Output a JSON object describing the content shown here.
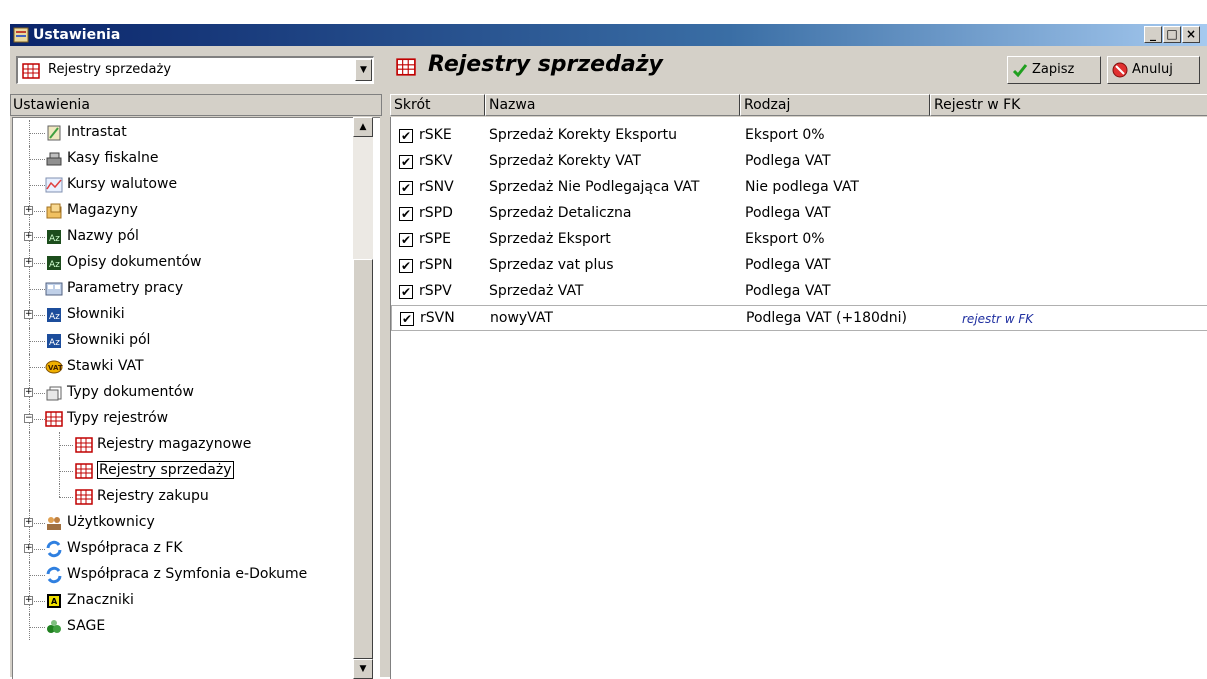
{
  "window": {
    "title": "Ustawienia",
    "controls": [
      "_",
      "□",
      "×"
    ]
  },
  "left": {
    "combo_value": "Rejestry sprzedaży",
    "header": "Ustawienia",
    "tree": [
      {
        "label": "Intrastat",
        "icon": "intrastat-icon",
        "expandable": false,
        "level": 1
      },
      {
        "label": "Kasy fiskalne",
        "icon": "cash-register-icon",
        "expandable": false,
        "level": 1
      },
      {
        "label": "Kursy walutowe",
        "icon": "chart-icon",
        "expandable": false,
        "level": 1
      },
      {
        "label": "Magazyny",
        "icon": "warehouse-icon",
        "expandable": true,
        "level": 1
      },
      {
        "label": "Nazwy pól",
        "icon": "az-green-icon",
        "expandable": true,
        "level": 1
      },
      {
        "label": "Opisy dokumentów",
        "icon": "az-green-icon",
        "expandable": true,
        "level": 1
      },
      {
        "label": "Parametry pracy",
        "icon": "parameters-icon",
        "expandable": false,
        "level": 1
      },
      {
        "label": "Słowniki",
        "icon": "az-blue-icon",
        "expandable": true,
        "level": 1
      },
      {
        "label": "Słowniki pól",
        "icon": "az-blue-icon",
        "expandable": false,
        "level": 1
      },
      {
        "label": "Stawki VAT",
        "icon": "vat-icon",
        "expandable": false,
        "level": 1
      },
      {
        "label": "Typy dokumentów",
        "icon": "documents-icon",
        "expandable": true,
        "level": 1
      },
      {
        "label": "Typy rejestrów",
        "icon": "register-icon",
        "expandable": true,
        "expanded": true,
        "level": 1
      },
      {
        "label": "Rejestry magazynowe",
        "icon": "register-icon",
        "expandable": false,
        "level": 2
      },
      {
        "label": "Rejestry sprzedaży",
        "icon": "register-icon",
        "expandable": false,
        "level": 2,
        "selected": true
      },
      {
        "label": "Rejestry zakupu",
        "icon": "register-icon",
        "expandable": false,
        "level": 2
      },
      {
        "label": "Użytkownicy",
        "icon": "users-icon",
        "expandable": true,
        "level": 1
      },
      {
        "label": "Współpraca z FK",
        "icon": "sync-icon",
        "expandable": true,
        "level": 1
      },
      {
        "label": "Współpraca z Symfonia e-Dokume",
        "icon": "sync-icon",
        "expandable": false,
        "level": 1
      },
      {
        "label": "Znaczniki",
        "icon": "tag-icon",
        "expandable": true,
        "level": 1
      },
      {
        "label": "SAGE",
        "icon": "sage-icon",
        "expandable": false,
        "level": 1
      }
    ]
  },
  "right": {
    "title": "Rejestry sprzedaży",
    "save_label": "Zapisz",
    "cancel_label": "Anuluj",
    "columns": [
      "Skrót",
      "Nazwa",
      "Rodzaj",
      "Rejestr w FK"
    ],
    "rows": [
      {
        "checked": "✔",
        "code": "rSKE",
        "name": "Sprzedaż Korekty Eksportu",
        "kind": "Eksport 0%",
        "fk": ""
      },
      {
        "checked": "✔",
        "code": "rSKV",
        "name": "Sprzedaż Korekty VAT",
        "kind": "Podlega VAT",
        "fk": ""
      },
      {
        "checked": "✔",
        "code": "rSNV",
        "name": "Sprzedaż Nie Podlegająca VAT",
        "kind": "Nie podlega VAT",
        "fk": ""
      },
      {
        "checked": "✔",
        "code": "rSPD",
        "name": "Sprzedaż Detaliczna",
        "kind": "Podlega VAT",
        "fk": ""
      },
      {
        "checked": "✔",
        "code": "rSPE",
        "name": "Sprzedaż Eksport",
        "kind": "Eksport 0%",
        "fk": ""
      },
      {
        "checked": "✔",
        "code": "rSPN",
        "name": "Sprzedaz vat plus",
        "kind": "Podlega VAT",
        "fk": ""
      },
      {
        "checked": "✔",
        "code": "rSPV",
        "name": "Sprzedaż VAT",
        "kind": "Podlega VAT",
        "fk": ""
      },
      {
        "checked": "✔",
        "code": "rSVN",
        "name": "nowyVAT",
        "kind": "Podlega VAT (+180dni)",
        "fk": "rejestr w FK"
      }
    ]
  },
  "colors": {
    "title_start": "#0a246a",
    "title_end": "#a6caf0",
    "face": "#d4d0c8",
    "fk_text": "#1f2fa0"
  }
}
